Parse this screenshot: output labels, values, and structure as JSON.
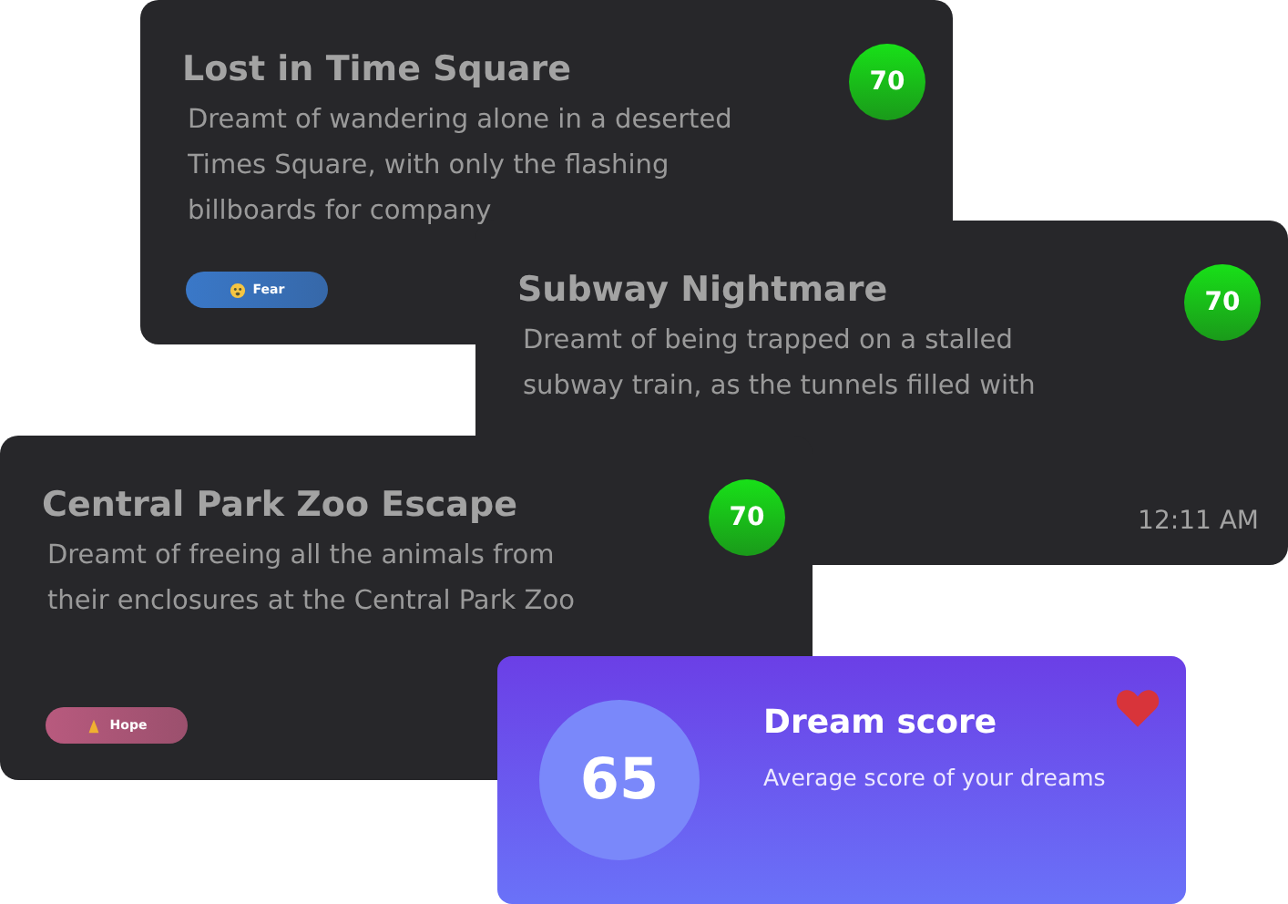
{
  "dream_cards": [
    {
      "title": "Lost in Time Square",
      "score": "70",
      "description": "Dreamt of wandering alone in a deserted Times Square, with only the flashing billboards for company",
      "tag": {
        "label": "Fear",
        "kind": "fear",
        "color": "#3a78c8"
      }
    },
    {
      "title": "Subway Nightmare",
      "score": "70",
      "description": "Dreamt of being trapped on a stalled subway train, as the tunnels filled with",
      "time": "12:11 AM"
    },
    {
      "title": "Central Park Zoo Escape",
      "score": "70",
      "description": "Dreamt of freeing all the animals from their enclosures at the Central Park Zoo",
      "tag": {
        "label": "Hope",
        "kind": "hope",
        "color": "#b85a7e"
      }
    }
  ],
  "score_card": {
    "score": "65",
    "title": "Dream score",
    "subtitle": "Average score of your dreams"
  }
}
